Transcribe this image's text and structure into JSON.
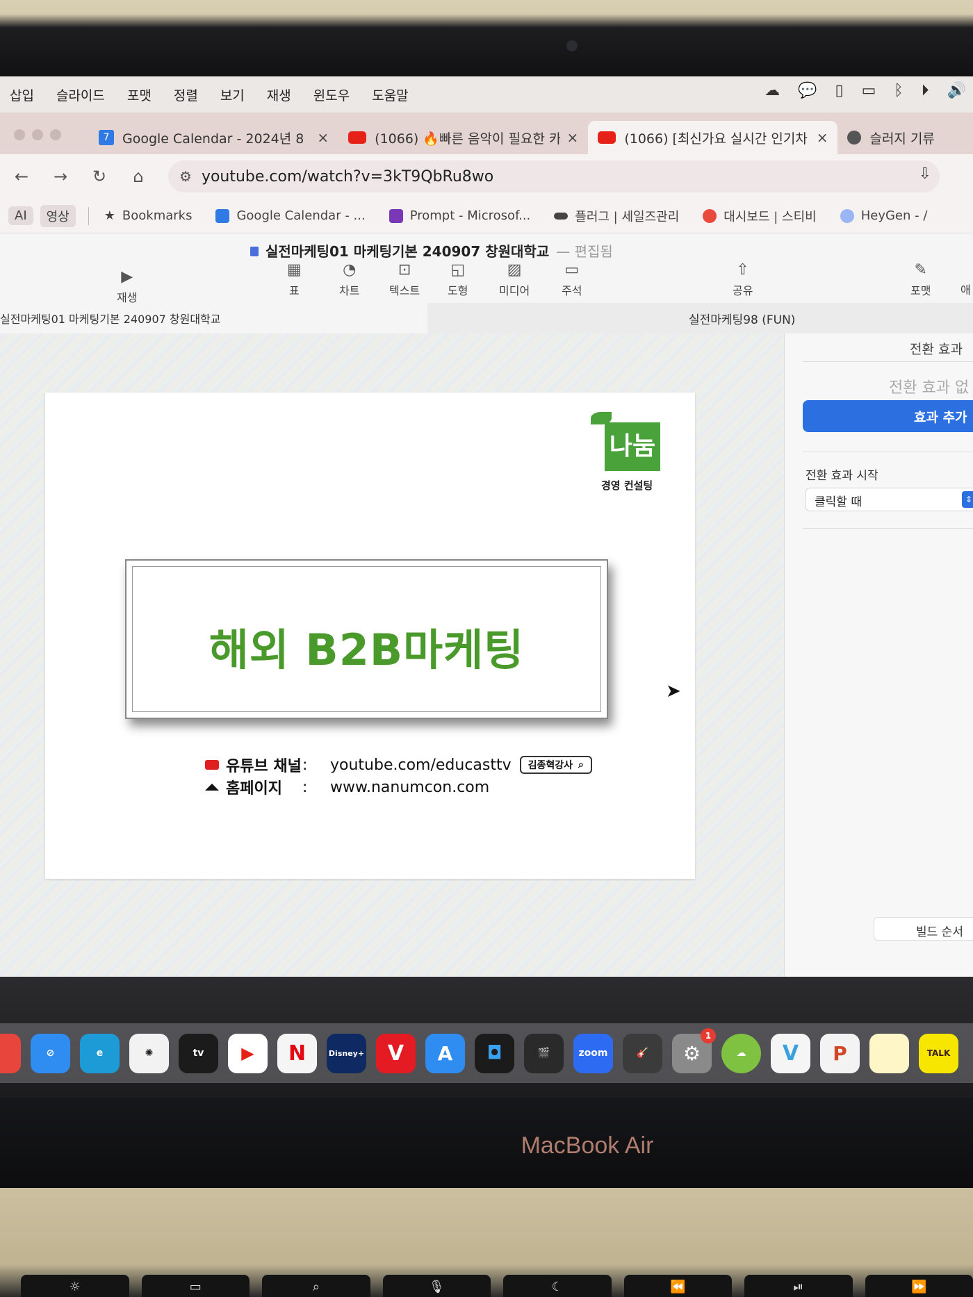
{
  "menubar": {
    "items": [
      "삽입",
      "슬라이드",
      "포맷",
      "정렬",
      "보기",
      "재생",
      "윈도우",
      "도움말"
    ]
  },
  "tabs": [
    {
      "title": "Google Calendar - 2024년 8",
      "favicon": "calendar-icon",
      "close": "×"
    },
    {
      "title": "(1066) 🔥빠른 음악이 필요한 카",
      "favicon": "youtube-icon",
      "close": "×"
    },
    {
      "title": "(1066) [최신가요 실시간 인기차",
      "favicon": "youtube-icon",
      "close": "×",
      "active": true
    },
    {
      "title": "슬러지 기류",
      "favicon": "chatgpt-icon"
    }
  ],
  "addressbar": {
    "url": "youtube.com/watch?v=3kT9QbRu8wo"
  },
  "bookmarks": {
    "chips": [
      "AI",
      "영상"
    ],
    "items": [
      {
        "label": "Bookmarks",
        "icon": "star-icon"
      },
      {
        "label": "Google Calendar - ...",
        "icon": "calendar-icon"
      },
      {
        "label": "Prompt - Microsof...",
        "icon": "onenote-icon"
      },
      {
        "label": "플러그 | 세일즈관리",
        "icon": "toggle-icon"
      },
      {
        "label": "대시보드 | 스티비",
        "icon": "stibee-icon"
      },
      {
        "label": "HeyGen - /",
        "icon": "heygen-icon"
      }
    ]
  },
  "keynote": {
    "doc_title": "실전마케팅01 마케팅기본 240907 창원대학교",
    "doc_status": "— 편집됨",
    "play_label": "재생",
    "tools": [
      {
        "label": "표",
        "icon": "table-icon"
      },
      {
        "label": "차트",
        "icon": "chart-icon"
      },
      {
        "label": "텍스트",
        "icon": "text-icon"
      },
      {
        "label": "도형",
        "icon": "shape-icon"
      },
      {
        "label": "미디어",
        "icon": "media-icon"
      },
      {
        "label": "주석",
        "icon": "comment-icon"
      }
    ],
    "share_label": "공유",
    "format_label": "포맷",
    "animate_label": "애",
    "tab_left": "실전마케팅01 마케팅기본 240907 창원대학교",
    "tab_right": "실전마케팅98 (FUN)"
  },
  "slide": {
    "logo_text": "나눔",
    "logo_caption": "경영 컨설팅",
    "title": "해외 B2B마케팅",
    "youtube_label": "유튜브 채널",
    "youtube_value": "youtube.com/educasttv",
    "search_pill": "김종혁강사",
    "home_label": "홈페이지",
    "home_value": "www.nanumcon.com",
    "colon": ":"
  },
  "inspector": {
    "header": "전환 효과",
    "empty_text": "전환 효과 없",
    "add_button": "효과 추가",
    "start_label": "전환 효과 시작",
    "start_value": "클릭할 때",
    "build_order": "빌드 순서"
  },
  "dock": {
    "apps": [
      {
        "name": "chrome",
        "color": "#e8453c",
        "label": ""
      },
      {
        "name": "safari",
        "color": "#2f8cf0",
        "label": ""
      },
      {
        "name": "edge",
        "color": "#1d9bd7",
        "label": ""
      },
      {
        "name": "chatgpt",
        "color": "#f2f2f2",
        "label": ""
      },
      {
        "name": "apple-tv",
        "color": "#1b1b1b",
        "label": "tv"
      },
      {
        "name": "youtube",
        "color": "#ffffff",
        "label": ""
      },
      {
        "name": "netflix",
        "color": "#f5f5f5",
        "label": "N"
      },
      {
        "name": "disney-plus",
        "color": "#0f2a63",
        "label": "Disney+"
      },
      {
        "name": "tving",
        "color": "#e51b23",
        "label": "V"
      },
      {
        "name": "app-store",
        "color": "#2f8cf0",
        "label": "A"
      },
      {
        "name": "screenshot",
        "color": "#1b1b1b",
        "label": ""
      },
      {
        "name": "final-cut",
        "color": "#2a2a2a",
        "label": ""
      },
      {
        "name": "zoom",
        "color": "#2d6cf2",
        "label": "zoom"
      },
      {
        "name": "garageband",
        "color": "#3b3b3b",
        "label": ""
      },
      {
        "name": "system-settings",
        "color": "#8a8a8a",
        "label": "",
        "badge": "1"
      },
      {
        "name": "ddrive",
        "color": "#7fc241",
        "label": ""
      },
      {
        "name": "vrew",
        "color": "#f5f5f5",
        "label": "V"
      },
      {
        "name": "powerpoint",
        "color": "#f3f3f3",
        "label": "P"
      },
      {
        "name": "notes",
        "color": "#fff6c8",
        "label": ""
      },
      {
        "name": "kakaotalk",
        "color": "#f7e600",
        "label": "TALK"
      }
    ]
  },
  "hardware": {
    "brand": "MacBook Air"
  }
}
